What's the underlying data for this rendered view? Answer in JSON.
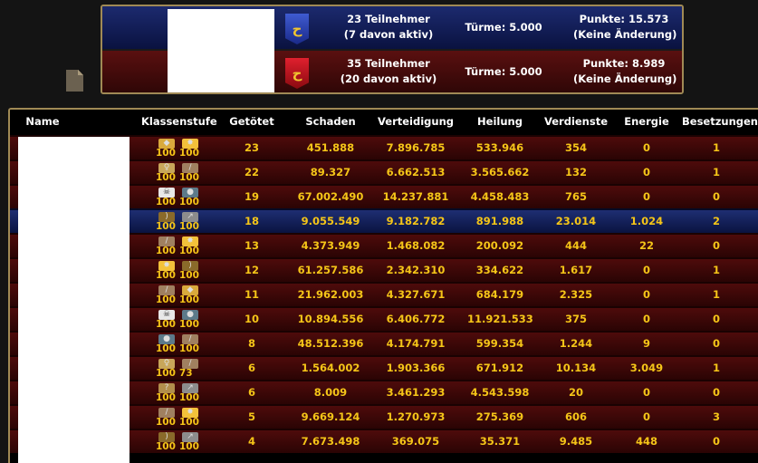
{
  "teams": [
    {
      "participants": "23 Teilnehmer",
      "active": "(7 davon aktiv)",
      "towers": "Türme:  5.000",
      "points": "Punkte:  15.573",
      "change": "(Keine Änderung)",
      "color": "#1c2a6e",
      "banner_icon": "blue-faction-banner-icon"
    },
    {
      "participants": "35 Teilnehmer",
      "active": "(20 davon aktiv)",
      "towers": "Türme:  5.000",
      "points": "Punkte:  8.989",
      "change": "(Keine Änderung)",
      "color": "#5a1010",
      "banner_icon": "red-faction-banner-icon"
    }
  ],
  "table": {
    "headers": [
      "Name",
      "Klassenstufe",
      "Getötet",
      "Schaden",
      "Verteidigung",
      "Heilung",
      "Verdienste",
      "Energie",
      "Besetzungen"
    ],
    "rows": [
      {
        "classes": [
          {
            "icon": "shield-icon",
            "level": "100"
          },
          {
            "icon": "star-burst-icon",
            "level": "100"
          }
        ],
        "kills": "23",
        "damage": "451.888",
        "defense": "7.896.785",
        "healing": "533.946",
        "merit": "354",
        "energy": "0",
        "captures": "1"
      },
      {
        "classes": [
          {
            "icon": "mage-icon",
            "level": "100"
          },
          {
            "icon": "blade-icon",
            "level": "100"
          }
        ],
        "kills": "22",
        "damage": "89.327",
        "defense": "6.662.513",
        "healing": "3.565.662",
        "merit": "132",
        "energy": "0",
        "captures": "1"
      },
      {
        "classes": [
          {
            "icon": "skull-icon",
            "level": "100"
          },
          {
            "icon": "rock-icon",
            "level": "100"
          }
        ],
        "kills": "19",
        "damage": "67.002.490",
        "defense": "14.237.881",
        "healing": "4.458.483",
        "merit": "765",
        "energy": "0",
        "captures": "0"
      },
      {
        "classes": [
          {
            "icon": "bow-icon",
            "level": "100"
          },
          {
            "icon": "lance-icon",
            "level": "100"
          }
        ],
        "kills": "18",
        "damage": "9.055.549",
        "defense": "9.182.782",
        "healing": "891.988",
        "merit": "23.014",
        "energy": "1.024",
        "captures": "2",
        "highlight": true
      },
      {
        "classes": [
          {
            "icon": "blade-icon",
            "level": "100"
          },
          {
            "icon": "star-burst-icon",
            "level": "100"
          }
        ],
        "kills": "13",
        "damage": "4.373.949",
        "defense": "1.468.082",
        "healing": "200.092",
        "merit": "444",
        "energy": "22",
        "captures": "0"
      },
      {
        "classes": [
          {
            "icon": "star-burst-icon",
            "level": "100"
          },
          {
            "icon": "bow-icon",
            "level": "100"
          }
        ],
        "kills": "12",
        "damage": "61.257.586",
        "defense": "2.342.310",
        "healing": "334.622",
        "merit": "1.617",
        "energy": "0",
        "captures": "1"
      },
      {
        "classes": [
          {
            "icon": "blade-icon",
            "level": "100"
          },
          {
            "icon": "shield-icon",
            "level": "100"
          }
        ],
        "kills": "11",
        "damage": "21.962.003",
        "defense": "4.327.671",
        "healing": "684.179",
        "merit": "2.325",
        "energy": "0",
        "captures": "1"
      },
      {
        "classes": [
          {
            "icon": "skull-icon",
            "level": "100"
          },
          {
            "icon": "rock-icon",
            "level": "100"
          }
        ],
        "kills": "10",
        "damage": "10.894.556",
        "defense": "6.406.772",
        "healing": "11.921.533",
        "merit": "375",
        "energy": "0",
        "captures": "0"
      },
      {
        "classes": [
          {
            "icon": "rock-icon",
            "level": "100"
          },
          {
            "icon": "blade-icon",
            "level": "100"
          }
        ],
        "kills": "8",
        "damage": "48.512.396",
        "defense": "4.174.791",
        "healing": "599.354",
        "merit": "1.244",
        "energy": "9",
        "captures": "0"
      },
      {
        "classes": [
          {
            "icon": "mage-icon",
            "level": "100"
          },
          {
            "icon": "blade-icon",
            "level": "73"
          }
        ],
        "kills": "6",
        "damage": "1.564.002",
        "defense": "1.903.366",
        "healing": "671.912",
        "merit": "10.134",
        "energy": "3.049",
        "captures": "1"
      },
      {
        "classes": [
          {
            "icon": "hook-icon",
            "level": "100"
          },
          {
            "icon": "lance-icon",
            "level": "100"
          }
        ],
        "kills": "6",
        "damage": "8.009",
        "defense": "3.461.293",
        "healing": "4.543.598",
        "merit": "20",
        "energy": "0",
        "captures": "0"
      },
      {
        "classes": [
          {
            "icon": "blade-icon",
            "level": "100"
          },
          {
            "icon": "star-burst-icon",
            "level": "100"
          }
        ],
        "kills": "5",
        "damage": "9.669.124",
        "defense": "1.270.973",
        "healing": "275.369",
        "merit": "606",
        "energy": "0",
        "captures": "3"
      },
      {
        "classes": [
          {
            "icon": "bow-icon",
            "level": "100"
          },
          {
            "icon": "lance-icon",
            "level": "100"
          }
        ],
        "kills": "4",
        "damage": "7.673.498",
        "defense": "369.075",
        "healing": "35.371",
        "merit": "9.485",
        "energy": "448",
        "captures": "0"
      }
    ]
  },
  "colors": {
    "gold_text": "#f5c518",
    "frame": "#a08a55",
    "row_red": "#4e0b0b",
    "row_blue": "#1e2e72"
  }
}
